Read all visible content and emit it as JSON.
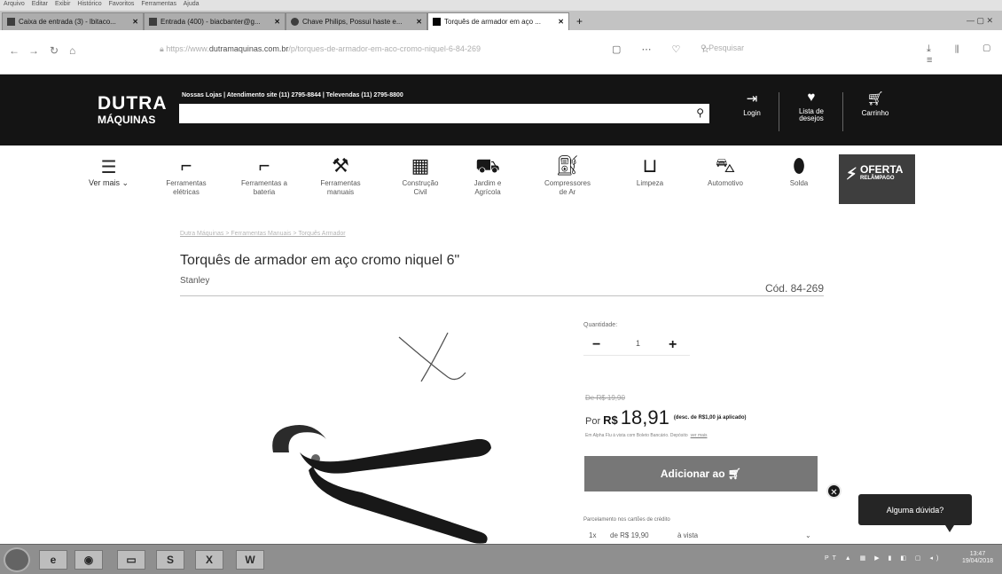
{
  "menubar": [
    "Arquivo",
    "Editar",
    "Exibir",
    "Histórico",
    "Favoritos",
    "Ferramentas",
    "Ajuda"
  ],
  "tabs": [
    {
      "label": "Caixa de entrada (3) - lbitaco...",
      "active": false
    },
    {
      "label": "Entrada (400) - biacbanter@g...",
      "active": false
    },
    {
      "label": "Chave Philips, Possui haste e...",
      "active": false
    },
    {
      "label": "Torquês de armador em aço ...",
      "active": true
    }
  ],
  "address": {
    "prefix": "https://www.",
    "domain": "dutramaquinas.com.br",
    "path": "/p/torques-de-armador-em-aco-cromo-niquel-6-84-269"
  },
  "browser_search_placeholder": "Pesquisar",
  "site": {
    "logo_line1": "DUTRA",
    "logo_line2": "MÁQUINAS",
    "contacts": "Nossas Lojas | Atendimento site (11) 2795-8844 | Televendas (11) 2795-8800",
    "login": "Login",
    "wishlist_1": "Lista de",
    "wishlist_2": "desejos",
    "cart": "Carrinho"
  },
  "categories": {
    "ver_mais": "Ver mais",
    "items": [
      {
        "l1": "Ferramentas",
        "l2": "elétricas",
        "icon": "drill-icon"
      },
      {
        "l1": "Ferramentas a",
        "l2": "bateria",
        "icon": "cordless-drill-icon"
      },
      {
        "l1": "Ferramentas",
        "l2": "manuais",
        "icon": "hand-tools-icon"
      },
      {
        "l1": "Construção",
        "l2": "Civil",
        "icon": "bricks-icon"
      },
      {
        "l1": "Jardim e",
        "l2": "Agrícola",
        "icon": "mower-icon"
      },
      {
        "l1": "Compressores",
        "l2": "de Ar",
        "icon": "compressor-icon"
      },
      {
        "l1": "Limpeza",
        "l2": "",
        "icon": "bucket-icon"
      },
      {
        "l1": "Automotivo",
        "l2": "",
        "icon": "car-icon"
      },
      {
        "l1": "Solda",
        "l2": "",
        "icon": "welding-mask-icon"
      }
    ],
    "oferta_1": "OFERTA",
    "oferta_2": "RELÂMPAGO"
  },
  "breadcrumb": "Dutra Máquinas > Ferramentas Manuais > Torquês Armador",
  "product": {
    "title": "Torquês de armador em aço cromo niquel 6\"",
    "brand": "Stanley",
    "code": "Cód. 84-269",
    "quantity_label": "Quantidade:",
    "quantity": "1",
    "old_price": "De R$ 19,90",
    "por": "Por",
    "currency": "R$",
    "price": "18,91",
    "discount": "(desc. de R$1,00 já aplicado)",
    "payment_note": "Em Alpha Flu à vista com Boleto Bancário. Depósito",
    "payment_link": "ver mais",
    "add_button": "Adicionar ao",
    "installments_label": "Parcelamento nos cartões de crédito",
    "inst_count": "1x",
    "inst_value": "de R$ 19,90",
    "inst_type": "à vista"
  },
  "help": "Alguma dúvida?",
  "taskbar": {
    "lang": "PT",
    "time": "13:47",
    "date": "19/04/2018"
  }
}
